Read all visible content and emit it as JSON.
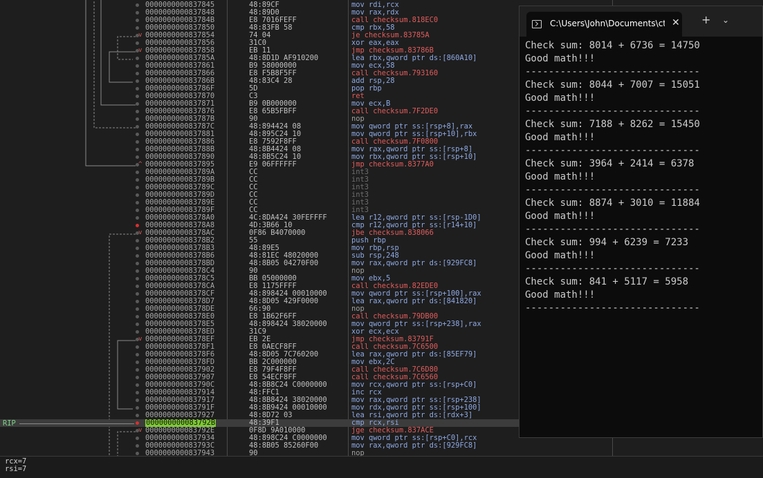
{
  "debugger": {
    "rip_label": "RIP",
    "rows": [
      {
        "dot": "n",
        "mk": "",
        "addr": "0000000000837845",
        "bytes": "48:89CF",
        "instr": "mov rdi,rcx",
        "cls": ""
      },
      {
        "dot": "n",
        "mk": "",
        "addr": "0000000000837848",
        "bytes": "48:89D0",
        "instr": "mov rax,rdx",
        "cls": ""
      },
      {
        "dot": "n",
        "mk": "",
        "addr": "000000000083784B",
        "bytes": "E8 7016FEFF",
        "instr": "call checksum.818EC0",
        "cls": "call"
      },
      {
        "dot": "n",
        "mk": "",
        "addr": "0000000000837850",
        "bytes": "48:83FB 58",
        "instr": "cmp rbx,58",
        "cls": ""
      },
      {
        "dot": "n",
        "mk": "v",
        "addr": "0000000000837854",
        "bytes": "74 04",
        "instr": "je checksum.83785A",
        "cls": "jmp"
      },
      {
        "dot": "n",
        "mk": "",
        "addr": "0000000000837856",
        "bytes": "31C0",
        "instr": "xor eax,eax",
        "cls": ""
      },
      {
        "dot": "n",
        "mk": "v",
        "addr": "0000000000837858",
        "bytes": "EB 11",
        "instr": "jmp checksum.83786B",
        "cls": "jmp"
      },
      {
        "dot": "n",
        "mk": "",
        "addr": "000000000083785A",
        "bytes": "48:8D1D AF910200",
        "instr": "lea rbx,qword ptr ds:[860A10]",
        "cls": ""
      },
      {
        "dot": "n",
        "mk": "",
        "addr": "0000000000837861",
        "bytes": "B9 58000000",
        "instr": "mov ecx,58",
        "cls": ""
      },
      {
        "dot": "n",
        "mk": "",
        "addr": "0000000000837866",
        "bytes": "E8 F5B8F5FF",
        "instr": "call checksum.793160",
        "cls": "call"
      },
      {
        "dot": "n",
        "mk": "",
        "addr": "000000000083786B",
        "bytes": "48:83C4 28",
        "instr": "add rsp,28",
        "cls": ""
      },
      {
        "dot": "n",
        "mk": "",
        "addr": "000000000083786F",
        "bytes": "5D",
        "instr": "pop rbp",
        "cls": ""
      },
      {
        "dot": "n",
        "mk": "",
        "addr": "0000000000837870",
        "bytes": "C3",
        "instr": "ret",
        "cls": "call"
      },
      {
        "dot": "n",
        "mk": "",
        "addr": "0000000000837871",
        "bytes": "B9 0B000000",
        "instr": "mov ecx,B",
        "cls": ""
      },
      {
        "dot": "n",
        "mk": "",
        "addr": "0000000000837876",
        "bytes": "E8 65B5FBFF",
        "instr": "call checksum.7F2DE0",
        "cls": "call"
      },
      {
        "dot": "n",
        "mk": "",
        "addr": "000000000083787B",
        "bytes": "90",
        "instr": "nop",
        "cls": "nop"
      },
      {
        "dot": "n",
        "mk": "",
        "addr": "000000000083787C",
        "bytes": "48:894424 08",
        "instr": "mov qword ptr ss:[rsp+8],rax",
        "cls": ""
      },
      {
        "dot": "n",
        "mk": "",
        "addr": "0000000000837881",
        "bytes": "48:895C24 10",
        "instr": "mov qword ptr ss:[rsp+10],rbx",
        "cls": ""
      },
      {
        "dot": "n",
        "mk": "",
        "addr": "0000000000837886",
        "bytes": "E8 7592F8FF",
        "instr": "call checksum.7F0800",
        "cls": "call"
      },
      {
        "dot": "n",
        "mk": "",
        "addr": "000000000083788B",
        "bytes": "48:8B4424 08",
        "instr": "mov rax,qword ptr ss:[rsp+8]",
        "cls": ""
      },
      {
        "dot": "n",
        "mk": "",
        "addr": "0000000000837890",
        "bytes": "48:8B5C24 10",
        "instr": "mov rbx,qword ptr ss:[rsp+10]",
        "cls": ""
      },
      {
        "dot": "n",
        "mk": "^",
        "addr": "0000000000837895",
        "bytes": "E9 06FFFFFF",
        "instr": "jmp checksum.8377A0",
        "cls": "jmp"
      },
      {
        "dot": "n",
        "mk": "",
        "addr": "000000000083789A",
        "bytes": "CC",
        "instr": "int3",
        "cls": "int3"
      },
      {
        "dot": "n",
        "mk": "",
        "addr": "000000000083789B",
        "bytes": "CC",
        "instr": "int3",
        "cls": "int3"
      },
      {
        "dot": "n",
        "mk": "",
        "addr": "000000000083789C",
        "bytes": "CC",
        "instr": "int3",
        "cls": "int3"
      },
      {
        "dot": "n",
        "mk": "",
        "addr": "000000000083789D",
        "bytes": "CC",
        "instr": "int3",
        "cls": "int3"
      },
      {
        "dot": "n",
        "mk": "",
        "addr": "000000000083789E",
        "bytes": "CC",
        "instr": "int3",
        "cls": "int3"
      },
      {
        "dot": "n",
        "mk": "",
        "addr": "000000000083789F",
        "bytes": "CC",
        "instr": "int3",
        "cls": "int3"
      },
      {
        "dot": "n",
        "mk": "",
        "addr": "00000000008378A0",
        "bytes": "4C:8DA424 30FEFFFF",
        "instr": "lea r12,qword ptr ss:[rsp-1D0]",
        "cls": ""
      },
      {
        "dot": "b",
        "mk": "",
        "addr": "00000000008378A8",
        "bytes": "4D:3B66 10",
        "instr": "cmp r12,qword ptr ss:[r14+10]",
        "cls": ""
      },
      {
        "dot": "n",
        "mk": "v",
        "addr": "00000000008378AC",
        "bytes": "0F86 B4070000",
        "instr": "jbe checksum.838066",
        "cls": "jmp"
      },
      {
        "dot": "n",
        "mk": "",
        "addr": "00000000008378B2",
        "bytes": "55",
        "instr": "push rbp",
        "cls": "push"
      },
      {
        "dot": "n",
        "mk": "",
        "addr": "00000000008378B3",
        "bytes": "48:89E5",
        "instr": "mov rbp,rsp",
        "cls": ""
      },
      {
        "dot": "n",
        "mk": "",
        "addr": "00000000008378B6",
        "bytes": "48:81EC 48020000",
        "instr": "sub rsp,248",
        "cls": ""
      },
      {
        "dot": "n",
        "mk": "",
        "addr": "00000000008378BD",
        "bytes": "48:8B05 04270F00",
        "instr": "mov rax,qword ptr ds:[929FC8]",
        "cls": ""
      },
      {
        "dot": "n",
        "mk": "",
        "addr": "00000000008378C4",
        "bytes": "90",
        "instr": "nop",
        "cls": "nop"
      },
      {
        "dot": "n",
        "mk": "",
        "addr": "00000000008378C5",
        "bytes": "BB 05000000",
        "instr": "mov ebx,5",
        "cls": ""
      },
      {
        "dot": "n",
        "mk": "",
        "addr": "00000000008378CA",
        "bytes": "E8 1175FFFF",
        "instr": "call checksum.82EDE0",
        "cls": "call"
      },
      {
        "dot": "n",
        "mk": "",
        "addr": "00000000008378CF",
        "bytes": "48:898424 00010000",
        "instr": "mov qword ptr ss:[rsp+100],rax",
        "cls": ""
      },
      {
        "dot": "n",
        "mk": "",
        "addr": "00000000008378D7",
        "bytes": "48:8D05 429F0000",
        "instr": "lea rax,qword ptr ds:[841820]",
        "cls": ""
      },
      {
        "dot": "n",
        "mk": "",
        "addr": "00000000008378DE",
        "bytes": "66:90",
        "instr": "nop",
        "cls": "nop"
      },
      {
        "dot": "n",
        "mk": "",
        "addr": "00000000008378E0",
        "bytes": "E8 1B62F6FF",
        "instr": "call checksum.79DB00",
        "cls": "call"
      },
      {
        "dot": "n",
        "mk": "",
        "addr": "00000000008378E5",
        "bytes": "48:898424 38020000",
        "instr": "mov qword ptr ss:[rsp+238],rax",
        "cls": ""
      },
      {
        "dot": "n",
        "mk": "",
        "addr": "00000000008378ED",
        "bytes": "31C9",
        "instr": "xor ecx,ecx",
        "cls": ""
      },
      {
        "dot": "n",
        "mk": "v",
        "addr": "00000000008378EF",
        "bytes": "EB 2E",
        "instr": "jmp checksum.83791F",
        "cls": "jmp"
      },
      {
        "dot": "n",
        "mk": "",
        "addr": "00000000008378F1",
        "bytes": "E8 0AECF8FF",
        "instr": "call checksum.7C6500",
        "cls": "call"
      },
      {
        "dot": "n",
        "mk": "",
        "addr": "00000000008378F6",
        "bytes": "48:8D05 7C760200",
        "instr": "lea rax,qword ptr ds:[85EF79]",
        "cls": ""
      },
      {
        "dot": "n",
        "mk": "",
        "addr": "00000000008378FD",
        "bytes": "BB 2C000000",
        "instr": "mov ebx,2C",
        "cls": ""
      },
      {
        "dot": "n",
        "mk": "",
        "addr": "0000000000837902",
        "bytes": "E8 79F4F8FF",
        "instr": "call checksum.7C6D80",
        "cls": "call"
      },
      {
        "dot": "n",
        "mk": "",
        "addr": "0000000000837907",
        "bytes": "E8 54ECF8FF",
        "instr": "call checksum.7C6560",
        "cls": "call"
      },
      {
        "dot": "n",
        "mk": "",
        "addr": "000000000083790C",
        "bytes": "48:8B8C24 C0000000",
        "instr": "mov rcx,qword ptr ss:[rsp+C0]",
        "cls": ""
      },
      {
        "dot": "n",
        "mk": "",
        "addr": "0000000000837914",
        "bytes": "48:FFC1",
        "instr": "inc rcx",
        "cls": ""
      },
      {
        "dot": "n",
        "mk": "",
        "addr": "0000000000837917",
        "bytes": "48:8B8424 38020000",
        "instr": "mov rax,qword ptr ss:[rsp+238]",
        "cls": ""
      },
      {
        "dot": "n",
        "mk": "",
        "addr": "000000000083791F",
        "bytes": "48:8B9424 00010000",
        "instr": "mov rdx,qword ptr ss:[rsp+100]",
        "cls": ""
      },
      {
        "dot": "n",
        "mk": "",
        "addr": "0000000000837927",
        "bytes": "48:8D72 03",
        "instr": "lea rsi,qword ptr ds:[rdx+3]",
        "cls": ""
      },
      {
        "dot": "b",
        "mk": "",
        "addr": "000000000083792B",
        "bytes": "48:39F1",
        "instr": "cmp rcx,rsi",
        "cls": "",
        "rip": true
      },
      {
        "dot": "n",
        "mk": "v",
        "addr": "000000000083792E",
        "bytes": "0F8D 9A010000",
        "instr": "jge checksum.837ACE",
        "cls": "jmp"
      },
      {
        "dot": "n",
        "mk": "",
        "addr": "0000000000837934",
        "bytes": "48:898C24 C0000000",
        "instr": "mov qword ptr ss:[rsp+C0],rcx",
        "cls": ""
      },
      {
        "dot": "n",
        "mk": "",
        "addr": "000000000083793C",
        "bytes": "48:8B05 85260F00",
        "instr": "mov rax,qword ptr ds:[929FC8]",
        "cls": ""
      },
      {
        "dot": "n",
        "mk": "",
        "addr": "0000000000837943",
        "bytes": "90",
        "instr": "nop",
        "cls": "nop"
      }
    ]
  },
  "info": {
    "line1": "rcx=7",
    "line2": "rsi=7"
  },
  "console": {
    "tab_title": "C:\\Users\\John\\Documents\\ctf",
    "close_glyph": "✕",
    "new_tab_glyph": "+",
    "dropdown_glyph": "⌄",
    "lines": [
      "Check sum: 8014 + 6736 = 14750",
      "Good math!!!",
      "------------------------------",
      "Check sum: 8044 + 7007 = 15051",
      "Good math!!!",
      "------------------------------",
      "Check sum: 7188 + 8262 = 15450",
      "Good math!!!",
      "------------------------------",
      "Check sum: 3964 + 2414 = 6378",
      "Good math!!!",
      "------------------------------",
      "Check sum: 8874 + 3010 = 11884",
      "Good math!!!",
      "------------------------------",
      "Check sum: 994 + 6239 = 7233",
      "Good math!!!",
      "------------------------------",
      "Check sum: 841 + 5117 = 5958",
      "Good math!!!",
      "------------------------------"
    ]
  }
}
